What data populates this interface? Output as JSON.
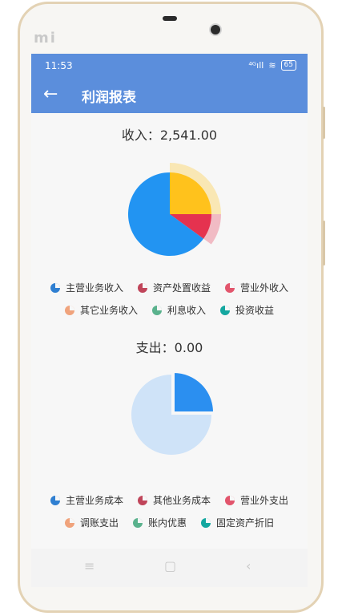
{
  "status": {
    "time": "11:53",
    "signal": "⁴ᴳıll",
    "wifi": "≋",
    "battery": "65"
  },
  "appbar": {
    "back_icon": "←",
    "title": "利润报表"
  },
  "income": {
    "label": "收入：2,541.00",
    "chart_data": {
      "type": "pie",
      "title": "收入：2,541.00",
      "series": [
        {
          "name": "主营业务收入",
          "value": 65,
          "color": "#2294f2"
        },
        {
          "name": "营业外收入",
          "value": 10,
          "color": "#e5324f"
        },
        {
          "name": "投资收益",
          "value": 25,
          "color": "#ffc21c"
        }
      ]
    },
    "legend": [
      {
        "label": "主营业务收入",
        "color": "#2f7fd1"
      },
      {
        "label": "资产处置收益",
        "color": "#c0455a"
      },
      {
        "label": "营业外收入",
        "color": "#e2556c"
      },
      {
        "label": "其它业务收入",
        "color": "#f0a37c"
      },
      {
        "label": "利息收入",
        "color": "#5ab28d"
      },
      {
        "label": "投资收益",
        "color": "#14a7a0"
      }
    ]
  },
  "expense": {
    "label": "支出：0.00",
    "chart_data": {
      "type": "pie",
      "title": "支出：0.00",
      "series": [
        {
          "name": "",
          "value": 25,
          "color": "#2b8ff0"
        },
        {
          "name": "",
          "value": 75,
          "color": "#cfe3f8"
        }
      ]
    },
    "legend": [
      {
        "label": "主营业务成本",
        "color": "#2f7fd1"
      },
      {
        "label": "其他业务成本",
        "color": "#c0455a"
      },
      {
        "label": "营业外支出",
        "color": "#e2556c"
      },
      {
        "label": "调账支出",
        "color": "#f0a37c"
      },
      {
        "label": "账内优惠",
        "color": "#5ab28d"
      },
      {
        "label": "固定资产折旧",
        "color": "#14a7a0"
      }
    ]
  },
  "device": {
    "brand": "mi",
    "nav": [
      "≡",
      "▢",
      "‹"
    ]
  }
}
